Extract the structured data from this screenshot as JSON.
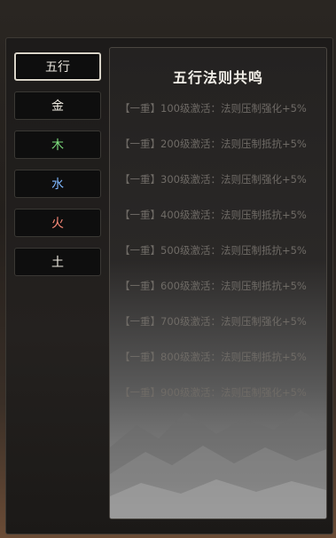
{
  "tabs": [
    {
      "label": "五行",
      "color": "#e8e4dc",
      "active": true
    },
    {
      "label": "金",
      "color": "#f0ece2"
    },
    {
      "label": "木",
      "color": "#7fe07f"
    },
    {
      "label": "水",
      "color": "#7fb8ff"
    },
    {
      "label": "火",
      "color": "#ff8c7a"
    },
    {
      "label": "土",
      "color": "#f0ece2"
    }
  ],
  "panel": {
    "title": "五行法则共鸣",
    "rows": [
      "【一重】100级激活：法则压制强化+5%",
      "【一重】200级激活：法则压制抵抗+5%",
      "【一重】300级激活：法则压制强化+5%",
      "【一重】400级激活：法则压制抵抗+5%",
      "【一重】500级激活：法则压制抵抗+5%",
      "【一重】600级激活：法则压制抵抗+5%",
      "【一重】700级激活：法则压制强化+5%",
      "【一重】800级激活：法则压制抵抗+5%",
      "【一重】900级激活：法则压制强化+5%"
    ],
    "row_color": "#6f6b66"
  }
}
